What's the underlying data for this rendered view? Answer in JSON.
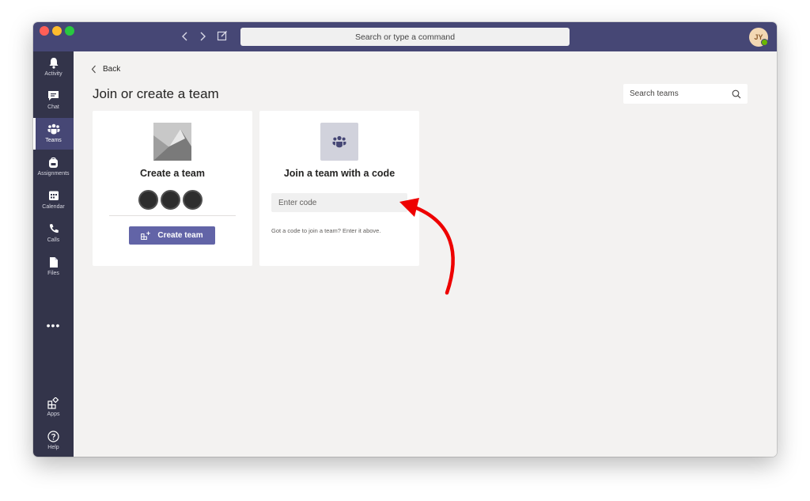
{
  "window": {
    "traffic_lights": [
      "close",
      "minimize",
      "zoom"
    ]
  },
  "titlebar": {
    "command_search": "Search or type a command",
    "avatar_initials": "JY",
    "presence_color": "#6bb700"
  },
  "rail": {
    "items": [
      {
        "label": "Activity",
        "icon": "bell-icon"
      },
      {
        "label": "Chat",
        "icon": "chat-icon"
      },
      {
        "label": "Teams",
        "icon": "teams-icon",
        "active": true
      },
      {
        "label": "Assignments",
        "icon": "backpack-icon"
      },
      {
        "label": "Calendar",
        "icon": "calendar-icon"
      },
      {
        "label": "Calls",
        "icon": "phone-icon"
      },
      {
        "label": "Files",
        "icon": "file-icon"
      }
    ],
    "more": "•••",
    "bottom_items": [
      {
        "label": "Apps",
        "icon": "apps-icon"
      },
      {
        "label": "Help",
        "icon": "help-icon"
      }
    ]
  },
  "content": {
    "back_label": "Back",
    "title": "Join or create a team",
    "search_placeholder": "Search teams"
  },
  "create_card": {
    "title": "Create a team",
    "button_label": "Create team"
  },
  "join_card": {
    "title": "Join a team with a code",
    "input_placeholder": "Enter code",
    "hint": "Got a code to join a team? Enter it above."
  },
  "colors": {
    "titlebar": "#464775",
    "rail": "#33344a",
    "accent": "#6264a7",
    "annotation_arrow": "#ee0000"
  }
}
